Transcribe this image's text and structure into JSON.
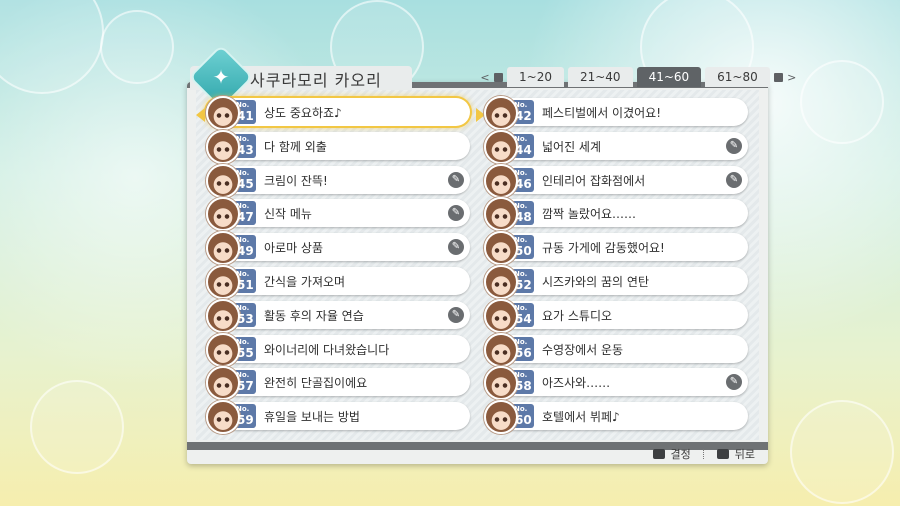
{
  "header": {
    "character_name": "사쿠라모리 카오리",
    "emblem_icon": "butterfly-emblem-icon"
  },
  "tabs": {
    "prev_icon": "<",
    "next_icon": ">",
    "items": [
      {
        "label": "1~20",
        "active": false
      },
      {
        "label": "21~40",
        "active": false
      },
      {
        "label": "41~60",
        "active": true
      },
      {
        "label": "61~80",
        "active": false
      }
    ]
  },
  "entries": [
    {
      "no_label": "No.",
      "number": "41",
      "title": "상도 중요하죠♪",
      "clip": false,
      "selected": true
    },
    {
      "no_label": "No.",
      "number": "42",
      "title": "페스티벌에서 이겼어요!",
      "clip": false
    },
    {
      "no_label": "No.",
      "number": "43",
      "title": "다 함께 외출",
      "clip": false
    },
    {
      "no_label": "No.",
      "number": "44",
      "title": "넓어진 세계",
      "clip": true
    },
    {
      "no_label": "No.",
      "number": "45",
      "title": "크림이 잔뜩!",
      "clip": true
    },
    {
      "no_label": "No.",
      "number": "46",
      "title": "인테리어 잡화점에서",
      "clip": true
    },
    {
      "no_label": "No.",
      "number": "47",
      "title": "신작 메뉴",
      "clip": true
    },
    {
      "no_label": "No.",
      "number": "48",
      "title": "깜짝 놀랐어요……",
      "clip": false
    },
    {
      "no_label": "No.",
      "number": "49",
      "title": "아로마 상품",
      "clip": true
    },
    {
      "no_label": "No.",
      "number": "50",
      "title": "규동 가게에 감동했어요!",
      "clip": false
    },
    {
      "no_label": "No.",
      "number": "51",
      "title": "간식을 가져오며",
      "clip": false
    },
    {
      "no_label": "No.",
      "number": "52",
      "title": "시즈카와의 꿈의 연탄",
      "clip": false
    },
    {
      "no_label": "No.",
      "number": "53",
      "title": "활동 후의 자율 연습",
      "clip": true
    },
    {
      "no_label": "No.",
      "number": "54",
      "title": "요가 스튜디오",
      "clip": false
    },
    {
      "no_label": "No.",
      "number": "55",
      "title": "와이너리에 다녀왔습니다",
      "clip": false
    },
    {
      "no_label": "No.",
      "number": "56",
      "title": "수영장에서 운동",
      "clip": false
    },
    {
      "no_label": "No.",
      "number": "57",
      "title": "완전히 단골집이에요",
      "clip": false
    },
    {
      "no_label": "No.",
      "number": "58",
      "title": "아즈사와……",
      "clip": true
    },
    {
      "no_label": "No.",
      "number": "59",
      "title": "휴일을 보내는 방법",
      "clip": false
    },
    {
      "no_label": "No.",
      "number": "60",
      "title": "호텔에서 뷔페♪",
      "clip": false
    }
  ],
  "footer": {
    "confirm_label": "결정",
    "back_label": "뒤로"
  },
  "colors": {
    "accent": "#5d79a8",
    "selection": "#f2c744",
    "active_tab": "#5f6366"
  }
}
